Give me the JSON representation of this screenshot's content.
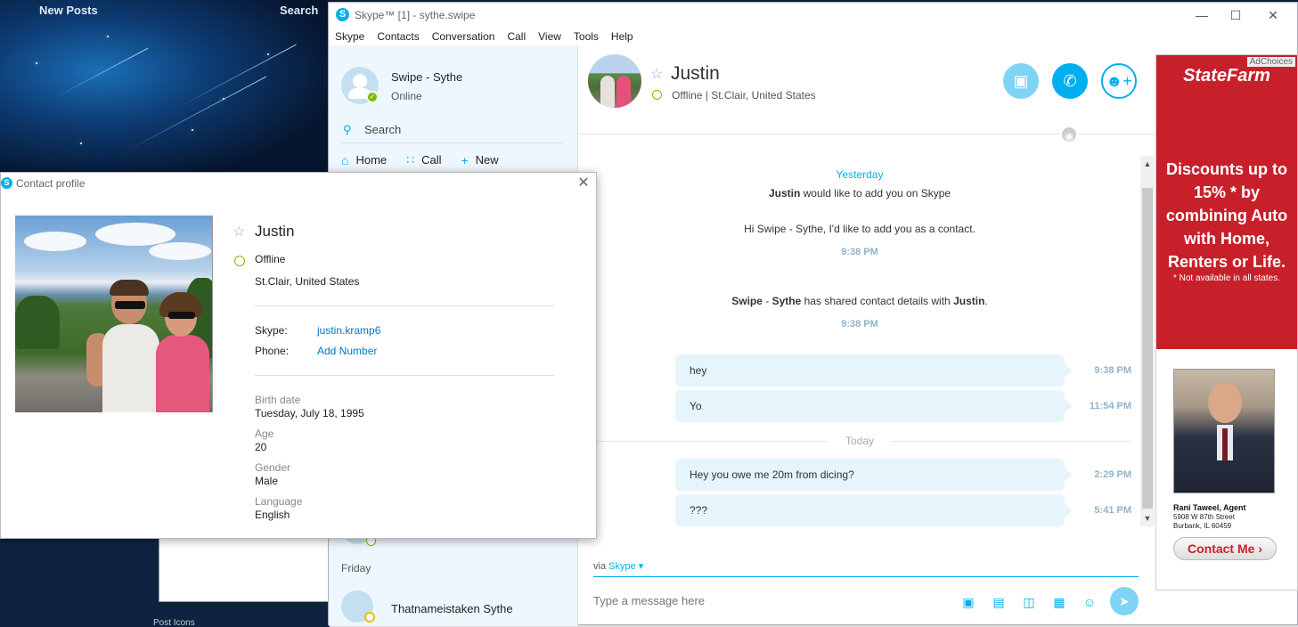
{
  "background": {
    "nav_new_posts": "New Posts",
    "nav_search": "Search",
    "post_icons": "Post Icons"
  },
  "skype": {
    "window_title": "Skype™ [1] - sythe.swipe",
    "menu": [
      "Skype",
      "Contacts",
      "Conversation",
      "Call",
      "View",
      "Tools",
      "Help"
    ],
    "me": {
      "name": "Swipe - Sythe",
      "mood": "Online"
    },
    "sidebar": {
      "search_label": "Search",
      "nav": [
        {
          "label": "Home",
          "icon": "home-icon"
        },
        {
          "label": "Call",
          "icon": "dialpad-icon"
        },
        {
          "label": "New",
          "icon": "plus-icon"
        }
      ],
      "section_friday": "Friday",
      "contact_friday": "Thatnameistaken Sythe"
    },
    "conversation": {
      "name": "Justin",
      "status": "Offline | St.Clair, United States",
      "day_yesterday": "Yesterday",
      "sys_msg_1_bold": "Justin",
      "sys_msg_1_rest": " would like to add you on Skype",
      "sys_msg_2": "Hi Swipe - Sythe, I'd like to add you as a contact.",
      "sys_time_1": "9:38 PM",
      "sys_msg_3_a": "Swipe",
      "sys_msg_3_b": " - ",
      "sys_msg_3_c": "Sythe",
      "sys_msg_3_d": " has shared contact details with ",
      "sys_msg_3_e": "Justin",
      "sys_msg_3_f": ".",
      "sys_time_2": "9:38 PM",
      "day_today": "Today",
      "messages": [
        {
          "text": "hey",
          "time": "9:38 PM"
        },
        {
          "text": "Yo",
          "time": "11:54 PM"
        },
        {
          "text": "Hey you owe me 20m from dicing?",
          "time": "2:29 PM"
        },
        {
          "text": "???",
          "time": "5:41 PM"
        }
      ],
      "via_label": "via",
      "via_service": "Skype",
      "composer_placeholder": "Type a message here"
    }
  },
  "ad": {
    "choices": "AdChoices",
    "brand": "StateFarm",
    "headline": "Discounts up to 15% * by combining Auto with Home, Renters or Life.",
    "fine_print": "* Not available in all states.",
    "agent_name": "Rani Taweel, Agent",
    "address_1": "5908 W 87th Street",
    "address_2": "Burbank, IL 60459",
    "cta": "Contact Me"
  },
  "profile": {
    "title": "Contact profile",
    "name": "Justin",
    "status": "Offline",
    "location": "St.Clair, United States",
    "skype_label": "Skype:",
    "skype_value": "justin.kramp6",
    "phone_label": "Phone:",
    "phone_value": "Add Number",
    "birth_label": "Birth date",
    "birth_value": "Tuesday, July 18, 1995",
    "age_label": "Age",
    "age_value": "20",
    "gender_label": "Gender",
    "gender_value": "Male",
    "language_label": "Language",
    "language_value": "English"
  },
  "colors": {
    "skype_blue": "#00aff0",
    "online_green": "#7fba00",
    "ad_red": "#c8202b"
  }
}
